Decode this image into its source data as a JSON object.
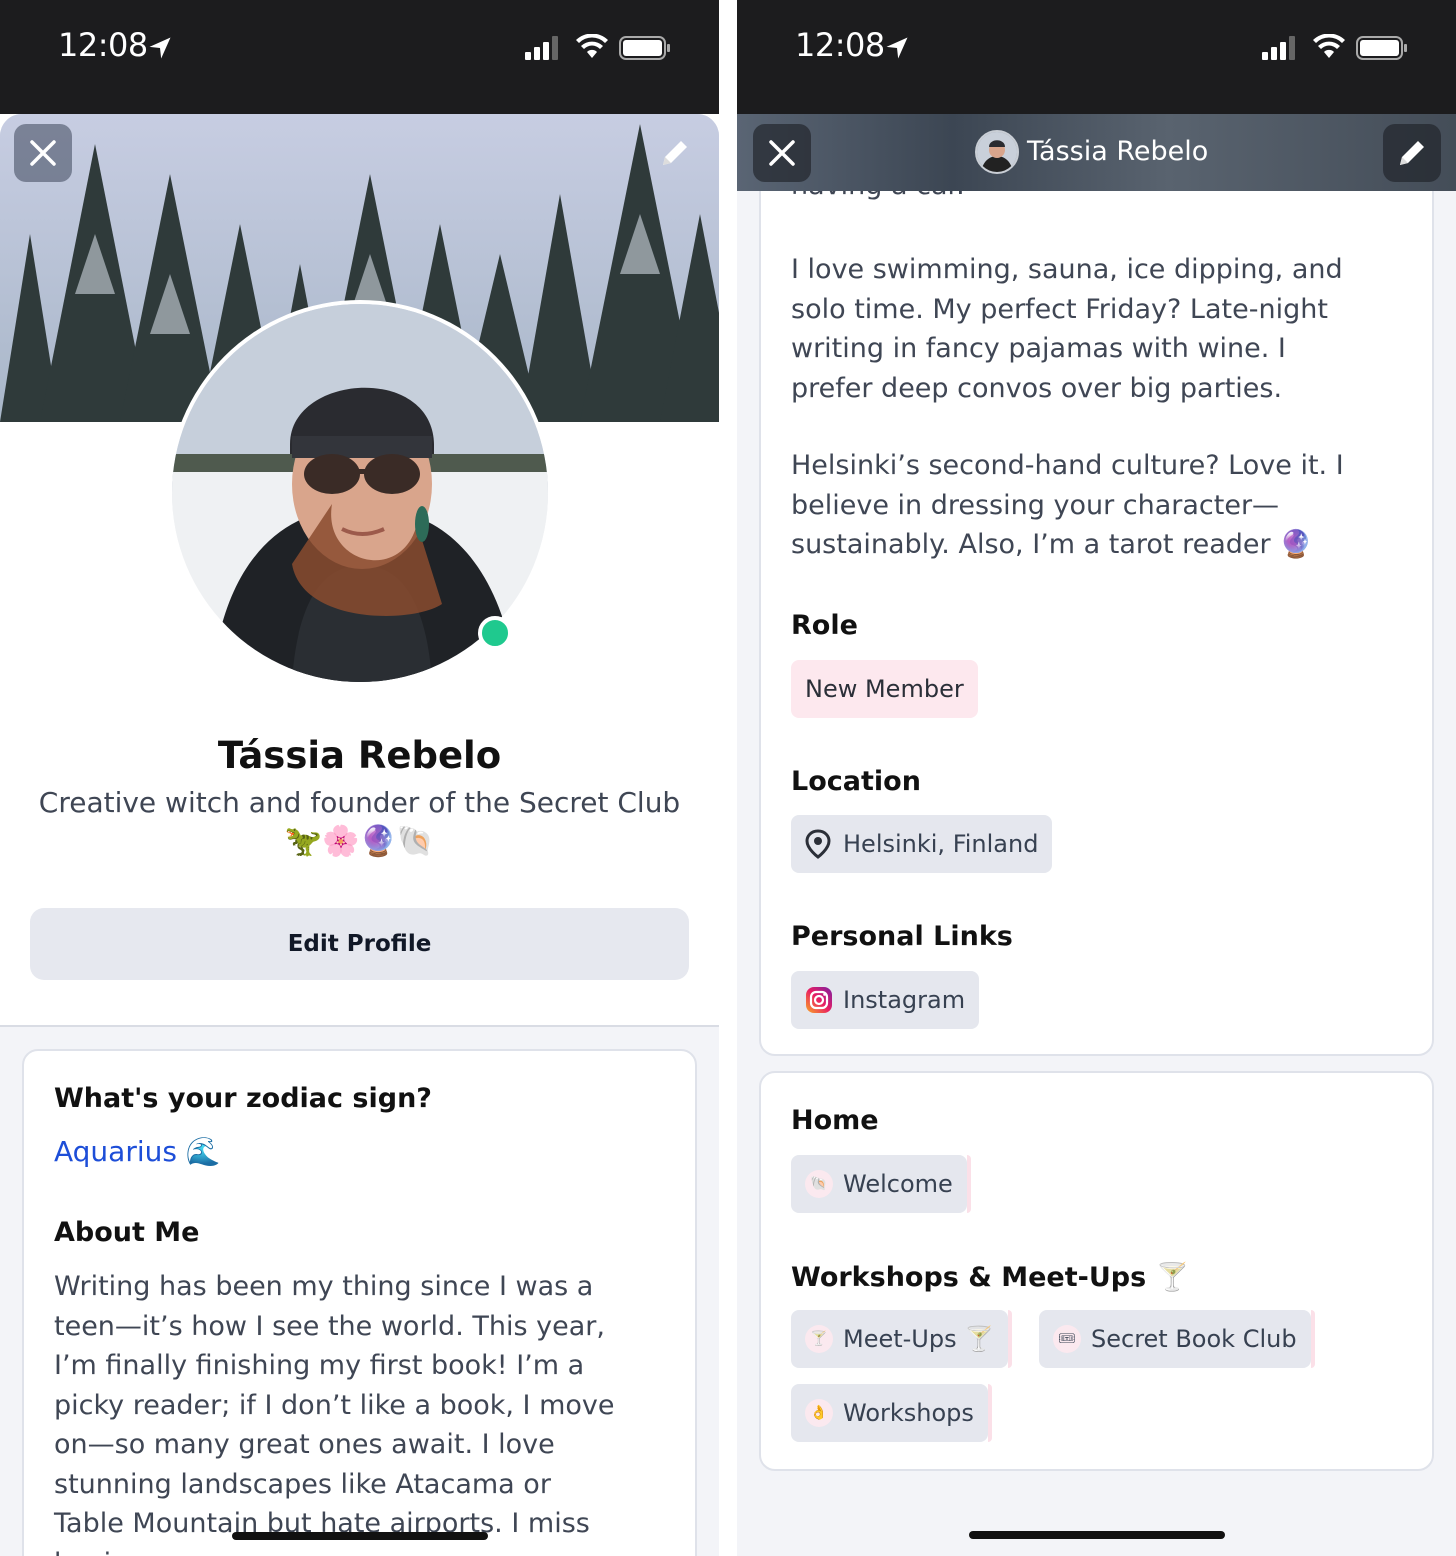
{
  "status": {
    "time": "12:08"
  },
  "left": {
    "profile_name": "Tássia Rebelo",
    "tagline": "Creative witch and founder of the Secret Club",
    "tagline_emoji": "🦖🌸🔮🐚",
    "edit_profile_label": "Edit Profile",
    "zodiac_question": "What's your zodiac sign?",
    "zodiac_answer": "Aquarius 🌊",
    "about_title": "About Me",
    "about_lines": [
      "Writing has been my thing since I was a",
      "teen—it’s how I see the world. This year,",
      "I’m finally finishing my first book! I’m a",
      "picky reader; if I don’t like a book, I move",
      "on—so many great ones await. I love",
      "stunning landscapes like Atacama or",
      "Table Mountain but hate airports. I miss",
      "having a car."
    ]
  },
  "right": {
    "nav_title": "Tássia Rebelo",
    "cut_line": "having a car.",
    "para1_lines": [
      "I love swimming, sauna, ice dipping, and",
      "solo time. My perfect Friday? Late-night",
      "writing in fancy pajamas with wine. I",
      "prefer deep convos over big parties."
    ],
    "para2_lines": [
      "Helsinki’s second-hand culture? Love it. I",
      "believe in dressing your character—",
      "sustainably. Also, I’m a tarot reader 🔮"
    ],
    "role_title": "Role",
    "role_value": "New Member",
    "location_title": "Location",
    "location_value": "Helsinki, Finland",
    "links_title": "Personal Links",
    "link_instagram": "Instagram",
    "home_title": "Home",
    "home_chip": "Welcome",
    "workshops_title": "Workshops & Meet-Ups 🍸",
    "chip_meetups": "Meet-Ups 🍸",
    "chip_bookclub": "Secret Book Club",
    "chip_workshops": "Workshops"
  },
  "colors": {
    "accent_link": "#1d4ed8",
    "online": "#1fc98e",
    "role_chip_bg": "#fde8ee",
    "chip_bg": "#e5e7ee",
    "status_bar": "#1c1c1e"
  },
  "icons": [
    "close-icon",
    "pencil-icon",
    "location-arrow-icon",
    "signal-icon",
    "wifi-icon",
    "battery-icon",
    "map-pin-icon",
    "instagram-icon",
    "shell-icon",
    "cocktail-icon",
    "ticket-icon",
    "hand-icon"
  ]
}
